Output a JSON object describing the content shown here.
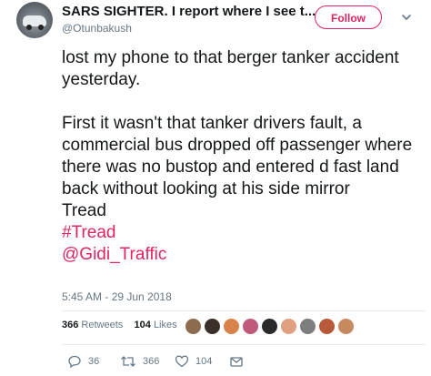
{
  "user": {
    "name": "SARS SIGHTER. I report where I see t...",
    "handle": "@Otunbakush"
  },
  "follow_label": "Follow",
  "tweet": {
    "paragraph1": "lost my phone to that berger tanker accident yesterday.",
    "paragraph2": "First it wasn't that tanker drivers fault, a commercial bus dropped off passenger where there was no bustop and entered d fast land back without looking at his side mirror",
    "tread": "Tread",
    "hashtag": "#Tread",
    "mention": "@Gidi_Traffic"
  },
  "timestamp": "5:45 AM - 29 Jun 2018",
  "stats": {
    "retweets_count": "366",
    "retweets_label": "Retweets",
    "likes_count": "104",
    "likes_label": "Likes"
  },
  "likers_avatar_colors": [
    "#8c6b4f",
    "#3b2f2a",
    "#d9834a",
    "#c05a7a",
    "#2a2a2a",
    "#e0a080",
    "#7d7d7d",
    "#b85a3a",
    "#c68a5e"
  ],
  "actions": {
    "reply_count": "36",
    "retweet_count": "366",
    "like_count": "104"
  },
  "colors": {
    "accent": "#e0245e",
    "secondary_text": "#657786"
  }
}
